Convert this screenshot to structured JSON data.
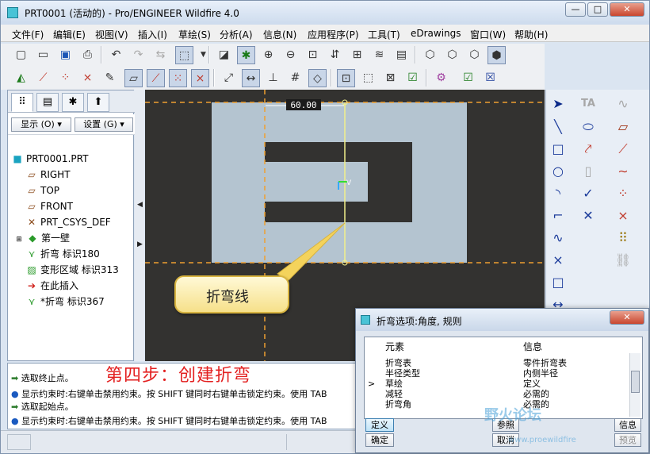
{
  "window": {
    "title": "PRT0001 (活动的) - Pro/ENGINEER Wildfire 4.0",
    "controls": {
      "minimize": "—",
      "maximize": "□",
      "close": "✕"
    }
  },
  "menu": [
    "文件(F)",
    "编辑(E)",
    "视图(V)",
    "插入(I)",
    "草绘(S)",
    "分析(A)",
    "信息(N)",
    "应用程序(P)",
    "工具(T)",
    "eDrawings",
    "窗口(W)",
    "帮助(H)"
  ],
  "left_panel": {
    "display_button": "显示 (O) ▾",
    "settings_button": "设置 (G) ▾",
    "tree": [
      {
        "icon": "part-icon",
        "label": "PRT0001.PRT",
        "indent": 0
      },
      {
        "icon": "datum-plane-icon",
        "label": "RIGHT",
        "indent": 1
      },
      {
        "icon": "datum-plane-icon",
        "label": "TOP",
        "indent": 1
      },
      {
        "icon": "datum-plane-icon",
        "label": "FRONT",
        "indent": 1
      },
      {
        "icon": "csys-icon",
        "label": "PRT_CSYS_DEF",
        "indent": 1
      },
      {
        "icon": "wall-icon",
        "label": "第一壁",
        "indent": 1
      },
      {
        "icon": "bend-icon",
        "label": "折弯 标识180",
        "indent": 1
      },
      {
        "icon": "deform-area-icon",
        "label": "变形区域 标识313",
        "indent": 1
      },
      {
        "icon": "insert-here-icon",
        "label": "在此插入",
        "indent": 1
      },
      {
        "icon": "bend-icon",
        "label": "*折弯 标识367",
        "indent": 1
      }
    ]
  },
  "canvas": {
    "dimension_label": "60.00",
    "callout_text": "折弯线",
    "colors": {
      "background": "#333230",
      "part": "#b4c4d0",
      "dashed": "#f0a030",
      "bend_line": "#f2f08a"
    }
  },
  "messages": [
    {
      "icon": "arrow-icon",
      "text": "选取终止点。"
    },
    {
      "icon": "bullet-icon",
      "text": "显示约束时:右键单击禁用约束。按 SHIFT 键同时右键单击锁定约束。使用 TAB"
    },
    {
      "icon": "arrow-icon",
      "text": "选取起始点。"
    },
    {
      "icon": "bullet-icon",
      "text": "显示约束时:右键单击禁用约束。按 SHIFT 键同时右键单击锁定约束。使用 TAB"
    }
  ],
  "step_caption": "第四步：创建折弯",
  "dialog": {
    "title": "折弯选项:角度, 规则",
    "col_element": "元素",
    "col_info": "信息",
    "rows": [
      {
        "element": "折弯表",
        "info": "零件折弯表",
        "marker": ""
      },
      {
        "element": "半径类型",
        "info": "内侧半径",
        "marker": ""
      },
      {
        "element": "草绘",
        "info": "定义",
        "marker": ">"
      },
      {
        "element": "减轻",
        "info": "必需的",
        "marker": ""
      },
      {
        "element": "折弯角",
        "info": "必需的",
        "marker": ""
      }
    ],
    "buttons": {
      "define": "定义",
      "reference": "参照",
      "info": "信息",
      "ok": "确定",
      "cancel": "取消",
      "preview": "预览"
    }
  },
  "watermark": {
    "text": "野火论坛",
    "url": "www.proewildfire"
  }
}
